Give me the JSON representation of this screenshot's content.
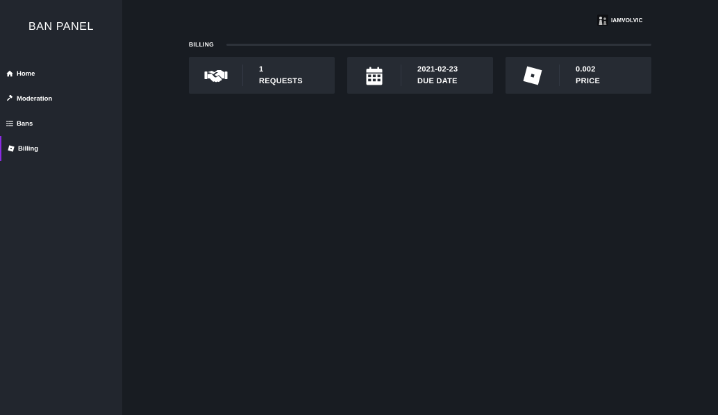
{
  "brand": {
    "title": "BAN PANEL"
  },
  "sidebar": {
    "items": [
      {
        "label": "Home",
        "icon": "home-icon",
        "active": false
      },
      {
        "label": "Moderation",
        "icon": "gavel-icon",
        "active": false
      },
      {
        "label": "Bans",
        "icon": "list-icon",
        "active": false
      },
      {
        "label": "Billing",
        "icon": "roblox-icon",
        "active": true
      }
    ]
  },
  "user": {
    "name": "IAMVOLVIC",
    "icon": "avatar-icon"
  },
  "section": {
    "title": "BILLING"
  },
  "cards": [
    {
      "value": "1",
      "caption": "REQUESTS",
      "icon": "handshake-icon"
    },
    {
      "value": "2021-02-23",
      "caption": "DUE DATE",
      "icon": "calendar-icon"
    },
    {
      "value": "0.002",
      "caption": "PRICE",
      "icon": "roblox-icon"
    }
  ],
  "colors": {
    "background": "#181c22",
    "sidebar": "#22262e",
    "card": "#262b33",
    "accent": "#8a2be2",
    "text": "#ffffff"
  }
}
